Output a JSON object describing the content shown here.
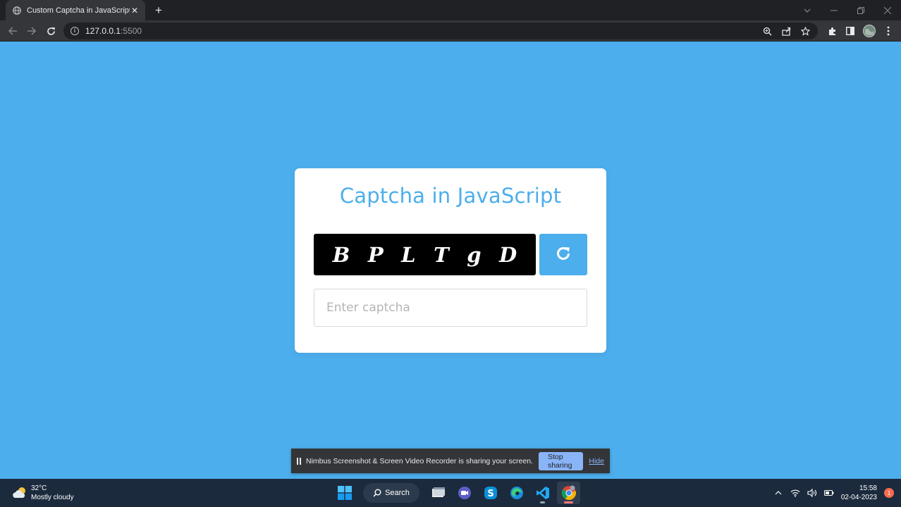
{
  "browser": {
    "tab_title": "Custom Captcha in JavaScript",
    "new_tab_label": "+",
    "url_host": "127.0.0.1",
    "url_port": ":5500"
  },
  "page": {
    "title": "Captcha in JavaScript",
    "captcha_chars": [
      "B",
      "P",
      "L",
      "T",
      "g",
      "D"
    ],
    "input_placeholder": "Enter captcha",
    "input_value": "",
    "colors": {
      "background": "#4caeec",
      "accent": "#4caeec",
      "captcha_bg": "#000000"
    }
  },
  "share_bar": {
    "message": "Nimbus Screenshot & Screen Video Recorder is sharing your screen.",
    "stop_label": "Stop sharing",
    "hide_label": "Hide"
  },
  "taskbar": {
    "weather_temp": "32°C",
    "weather_desc": "Mostly cloudy",
    "search_label": "Search",
    "time": "15:58",
    "date": "02-04-2023",
    "notification_count": "1",
    "icons": [
      "start-icon",
      "search-icon",
      "file-explorer-icon",
      "teams-icon",
      "skype-icon",
      "edge-icon",
      "vscode-icon",
      "chrome-icon"
    ]
  }
}
